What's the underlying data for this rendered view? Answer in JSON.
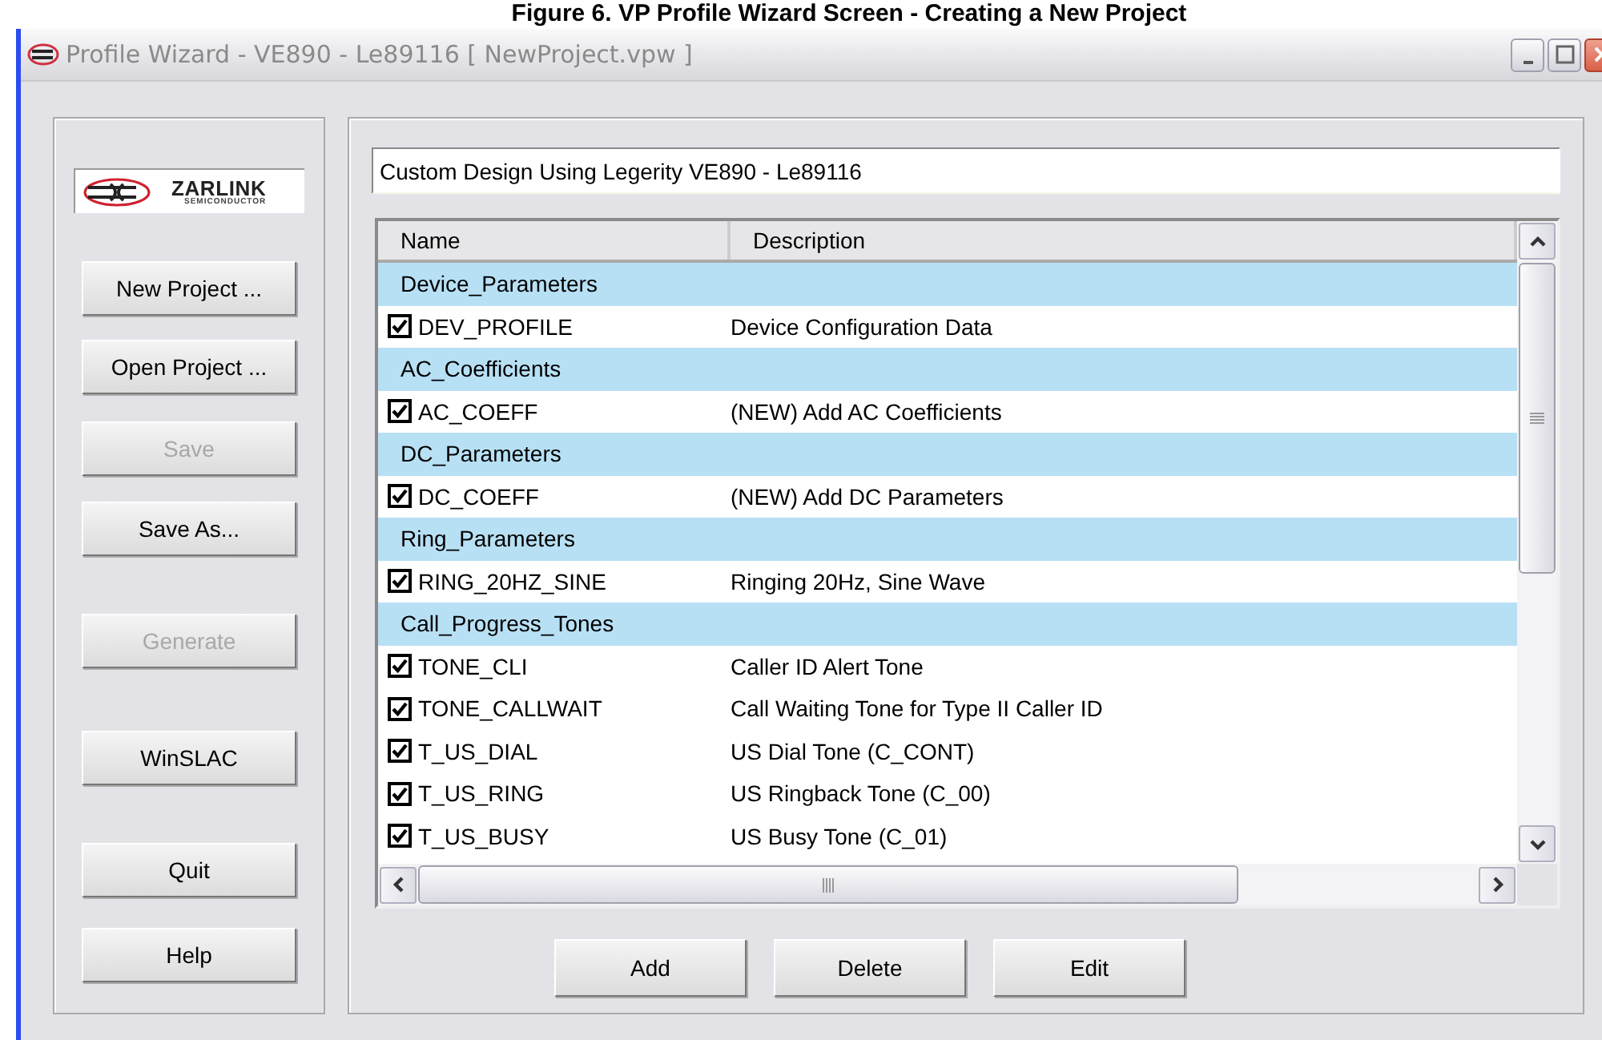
{
  "caption": "Figure 6.  VP Profile Wizard Screen - Creating a New Project",
  "window": {
    "title": "Profile Wizard - VE890 - Le89116  [ NewProject.vpw ]"
  },
  "logo": {
    "name": "ZARLINK",
    "tagline": "SEMICONDUCTOR"
  },
  "sidebar_buttons": [
    {
      "label": "New Project ...",
      "disabled": false
    },
    {
      "label": "Open Project ...",
      "disabled": false
    },
    {
      "label": "Save",
      "disabled": true
    },
    {
      "label": "Save As...",
      "disabled": false
    },
    {
      "label": "Generate",
      "disabled": true
    },
    {
      "label": "WinSLAC",
      "disabled": false
    },
    {
      "label": "Quit",
      "disabled": false
    },
    {
      "label": "Help",
      "disabled": false
    }
  ],
  "project_description": "Custom Design Using Legerity VE890 - Le89116",
  "table": {
    "columns": [
      "Name",
      "Description"
    ],
    "rows": [
      {
        "kind": "group",
        "name": "Device_Parameters"
      },
      {
        "kind": "item",
        "name": "DEV_PROFILE",
        "description": "Device Configuration Data",
        "checked": true
      },
      {
        "kind": "group",
        "name": "AC_Coefficients"
      },
      {
        "kind": "item",
        "name": "AC_COEFF",
        "description": "(NEW) Add AC Coefficients",
        "checked": true
      },
      {
        "kind": "group",
        "name": "DC_Parameters"
      },
      {
        "kind": "item",
        "name": "DC_COEFF",
        "description": "(NEW) Add DC Parameters",
        "checked": true
      },
      {
        "kind": "group",
        "name": "Ring_Parameters"
      },
      {
        "kind": "item",
        "name": "RING_20HZ_SINE",
        "description": "Ringing 20Hz, Sine Wave",
        "checked": true
      },
      {
        "kind": "group",
        "name": "Call_Progress_Tones"
      },
      {
        "kind": "item",
        "name": "TONE_CLI",
        "description": "Caller ID Alert Tone",
        "checked": true
      },
      {
        "kind": "item",
        "name": "TONE_CALLWAIT",
        "description": "Call Waiting Tone for Type II Caller ID",
        "checked": true
      },
      {
        "kind": "item",
        "name": "T_US_DIAL",
        "description": "US Dial Tone (C_CONT)",
        "checked": true
      },
      {
        "kind": "item",
        "name": "T_US_RING",
        "description": "US Ringback Tone (C_00)",
        "checked": true
      },
      {
        "kind": "item",
        "name": "T_US_BUSY",
        "description": "US Busy Tone (C_01)",
        "checked": true
      }
    ]
  },
  "buttons": [
    "Add",
    "Delete",
    "Edit"
  ]
}
